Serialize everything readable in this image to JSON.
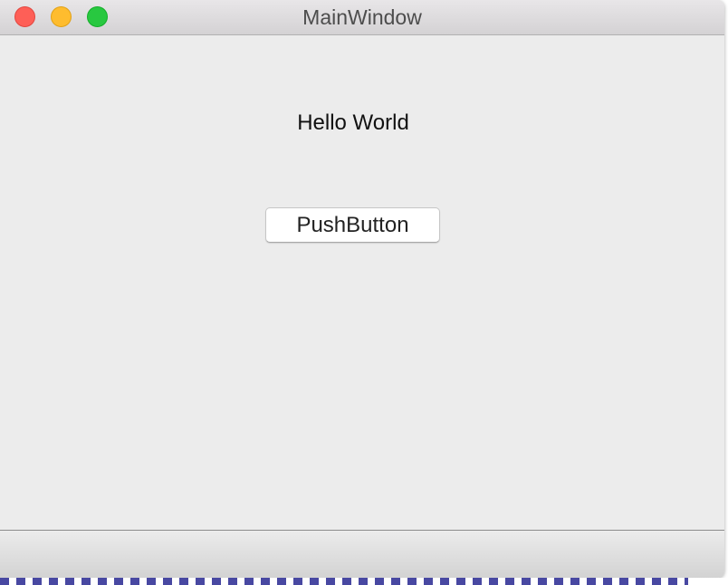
{
  "window": {
    "title": "MainWindow",
    "traffic_lights": {
      "close_color": "#fe5f57",
      "minimize_color": "#febc2e",
      "maximize_color": "#28c840"
    }
  },
  "content": {
    "label_text": "Hello World",
    "button_label": "PushButton"
  },
  "colors": {
    "window_background": "#ececec",
    "titlebar_text": "#4d4d4d"
  }
}
